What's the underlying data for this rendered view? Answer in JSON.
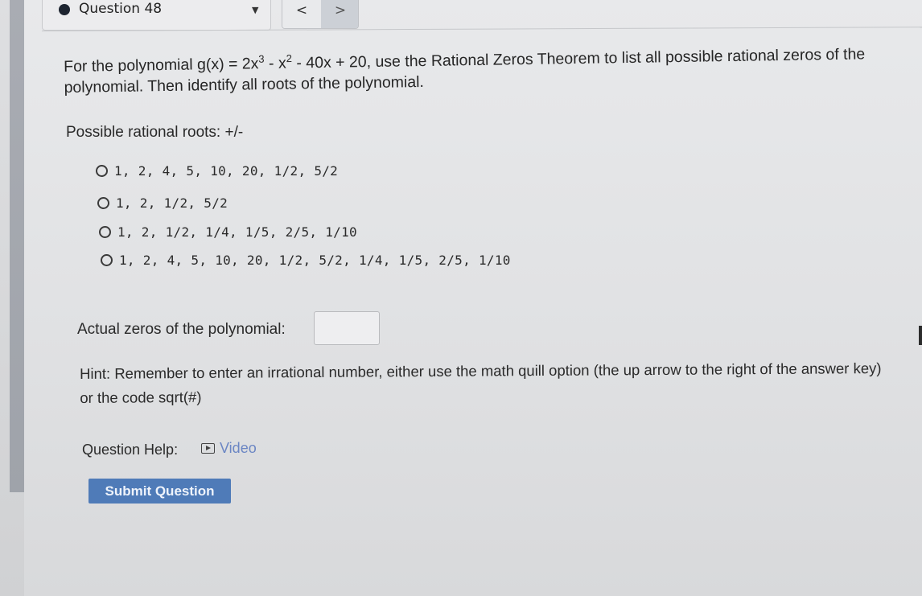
{
  "header": {
    "question_label": "Question 48",
    "prev_symbol": "<",
    "next_symbol": ">"
  },
  "question": {
    "text_before": "For the polynomial g(x) = 2x",
    "exp1": "3",
    "text_mid1": " - x",
    "exp2": "2",
    "text_after": " - 40x + 20, use the Rational Zeros Theorem to list all possible rational zeros of the polynomial. Then identify all roots of the polynomial."
  },
  "roots": {
    "label": "Possible rational roots: +/-",
    "options": [
      "1, 2, 4, 5, 10, 20, 1/2, 5/2",
      "1, 2, 1/2, 5/2",
      "1, 2, 1/2, 1/4, 1/5, 2/5, 1/10",
      "1, 2, 4, 5, 10, 20, 1/2, 5/2, 1/4, 1/5, 2/5, 1/10"
    ]
  },
  "zeros": {
    "label": "Actual zeros of the polynomial:",
    "value": ""
  },
  "hint": "Hint: Remember to enter an irrational number, either use the math quill option (the up arrow to the right of the answer key) or the code sqrt(#)",
  "help": {
    "label": "Question Help:",
    "video_label": "Video"
  },
  "submit_label": "Submit Question",
  "colors": {
    "submit_bg": "#4f7bb8",
    "link": "#6b86c4"
  }
}
